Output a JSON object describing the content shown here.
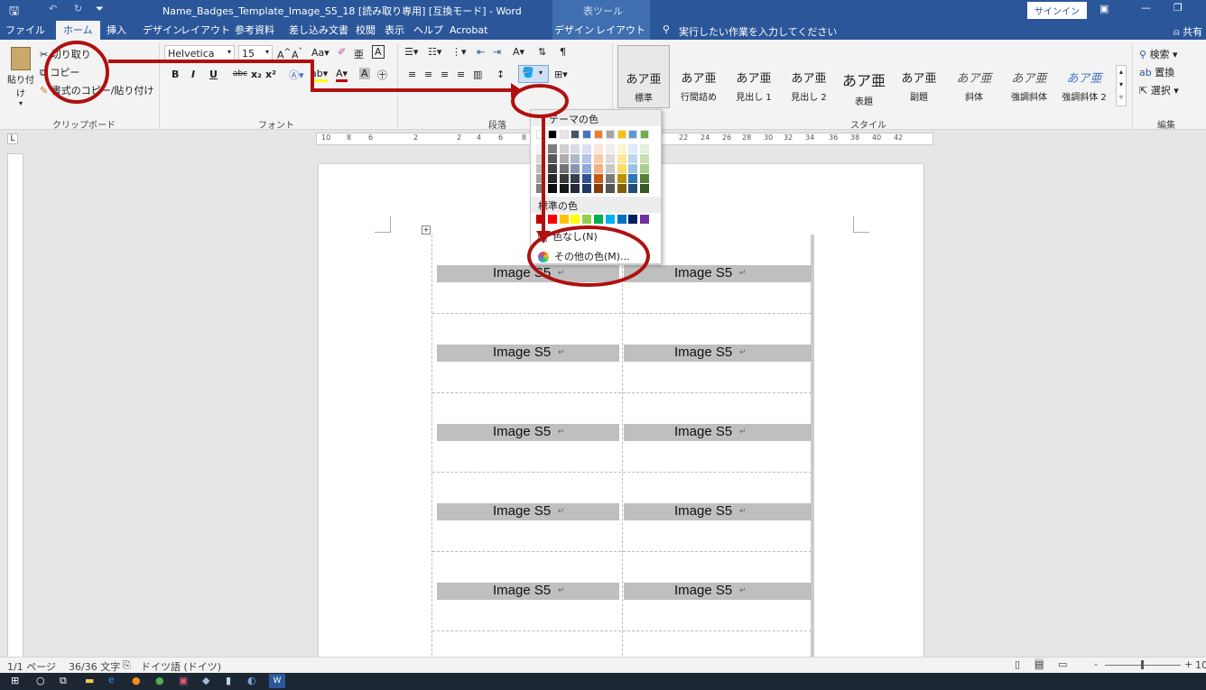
{
  "app": {
    "window_title": "Name_Badges_Template_Image_S5_18 [読み取り専用] [互換モード] - Word",
    "context_tab_header": "表ツール",
    "sign_in": "サインイン",
    "share": "共有"
  },
  "tabs": [
    "ファイル",
    "ホーム",
    "挿入",
    "デザイン",
    "レイアウト",
    "参考資料",
    "差し込み文書",
    "校閲",
    "表示",
    "ヘルプ",
    "Acrobat",
    "デザイン",
    "レイアウト"
  ],
  "tell_me": "実行したい作業を入力してください",
  "clipboard": {
    "paste": "貼り付け",
    "cut": "切り取り",
    "copy": "コピー",
    "format_painter": "書式のコピー/貼り付け",
    "label": "クリップボード"
  },
  "font": {
    "name": "Helvetica",
    "size": "15",
    "label": "フォント",
    "bold": "B",
    "italic": "I",
    "underline": "U",
    "strike": "abc",
    "sub": "x₂",
    "sup": "x²"
  },
  "paragraph": {
    "label": "段落"
  },
  "styles": {
    "label": "スタイル",
    "items": [
      {
        "sample": "あア亜",
        "name": "標準"
      },
      {
        "sample": "あア亜",
        "name": "行間詰め"
      },
      {
        "sample": "あア亜",
        "name": "見出し 1"
      },
      {
        "sample": "あア亜",
        "name": "見出し 2"
      },
      {
        "sample": "あア亜",
        "name": "表題"
      },
      {
        "sample": "あア亜",
        "name": "副題"
      },
      {
        "sample": "あア亜",
        "name": "斜体"
      },
      {
        "sample": "あア亜",
        "name": "強調斜体"
      },
      {
        "sample": "あア亜",
        "name": "強調斜体 2"
      }
    ]
  },
  "editing": {
    "label": "編集",
    "find": "検索",
    "replace": "置換",
    "select": "選択"
  },
  "ruler_numbers": [
    "10",
    "8",
    "6",
    "2",
    "2",
    "4",
    "6",
    "8",
    "22",
    "24",
    "26",
    "28",
    "30",
    "32",
    "34",
    "36",
    "38",
    "40",
    "42"
  ],
  "shading_menu": {
    "theme_colors_label": "テーマの色",
    "standard_colors_label": "標準の色",
    "no_color": "色なし(N)",
    "more_colors": "その他の色(M)...",
    "theme_top": [
      "#ffffff",
      "#000000",
      "#e7e6e6",
      "#44546a",
      "#4472c4",
      "#ed7d31",
      "#a5a5a5",
      "#ffc000",
      "#5b9bd5",
      "#70ad47"
    ],
    "theme_columns": [
      [
        "#f2f2f2",
        "#d8d8d8",
        "#bfbfbf",
        "#a5a5a5",
        "#7f7f7f"
      ],
      [
        "#7f7f7f",
        "#595959",
        "#3f3f3f",
        "#262626",
        "#0c0c0c"
      ],
      [
        "#d0cece",
        "#aeabab",
        "#757171",
        "#3a3838",
        "#171616"
      ],
      [
        "#d6dce4",
        "#adb9ca",
        "#8497b0",
        "#333f4f",
        "#222a35"
      ],
      [
        "#d9e2f3",
        "#b4c6e7",
        "#8eaadb",
        "#2f5496",
        "#1f3864"
      ],
      [
        "#fbe5d5",
        "#f7cbac",
        "#f4b183",
        "#c55a11",
        "#833c0b"
      ],
      [
        "#ededed",
        "#dbdbdb",
        "#c9c9c9",
        "#7b7b7b",
        "#525252"
      ],
      [
        "#fff2cc",
        "#fee599",
        "#ffd965",
        "#bf9000",
        "#7f6000"
      ],
      [
        "#deebf6",
        "#bdd7ee",
        "#9cc3e5",
        "#2e75b5",
        "#1f4e79"
      ],
      [
        "#e2efd9",
        "#c5e0b3",
        "#a8d08d",
        "#538135",
        "#375623"
      ]
    ],
    "standard": [
      "#c00000",
      "#ff0000",
      "#ffc000",
      "#ffff00",
      "#92d050",
      "#00b050",
      "#00b0f0",
      "#0070c0",
      "#002060",
      "#7030a0"
    ]
  },
  "document": {
    "label_text": "Image S5",
    "rows": [
      [
        "Image S5",
        "Image S5"
      ],
      [
        "Image S5",
        "Image S5"
      ],
      [
        "Image S5",
        "Image S5"
      ],
      [
        "Image S5",
        "Image S5"
      ],
      [
        "Image S5",
        "Image S5"
      ]
    ]
  },
  "status": {
    "page": "1/1 ページ",
    "words": "36/36 文字",
    "language": "ドイツ語 (ドイツ)",
    "zoom": "10"
  },
  "colors": {
    "accent": "#2b579a",
    "annotation": "#b01010"
  }
}
